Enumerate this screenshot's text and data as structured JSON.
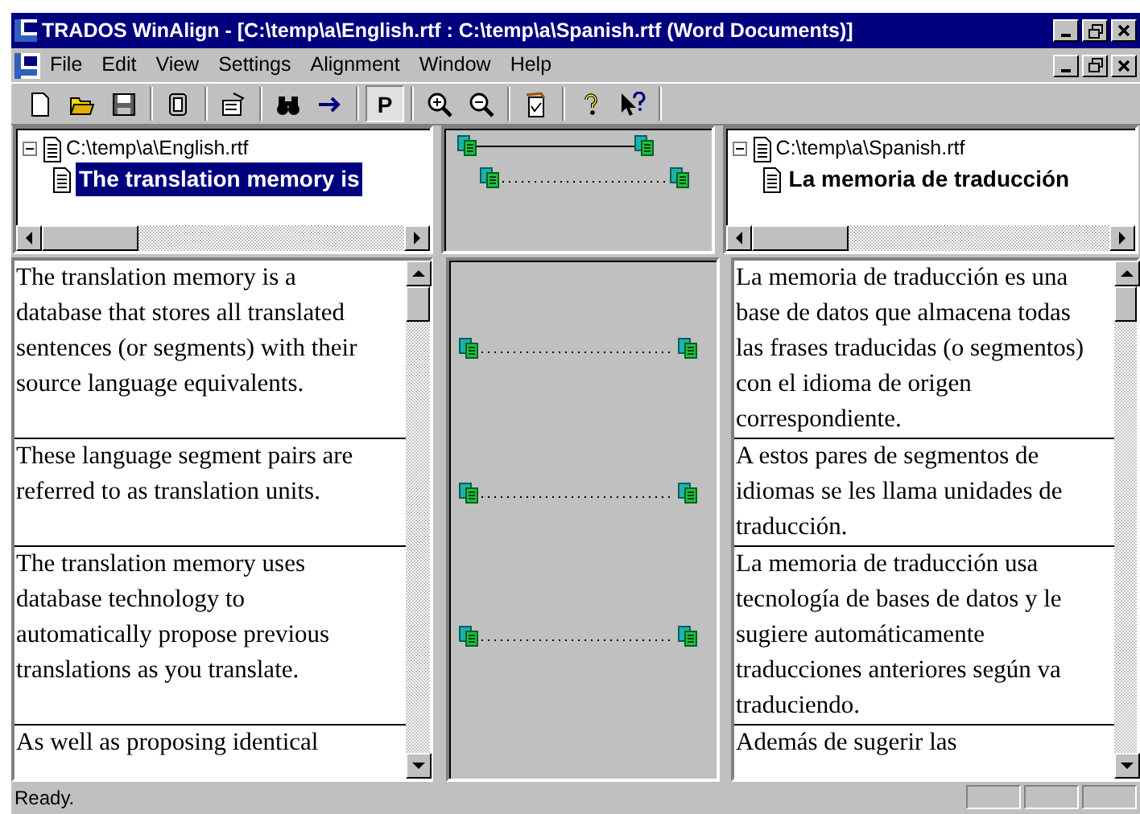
{
  "window": {
    "title": "TRADOS WinAlign - [C:\\temp\\a\\English.rtf : C:\\temp\\a\\Spanish.rtf (Word Documents)]"
  },
  "menu": [
    "File",
    "Edit",
    "View",
    "Settings",
    "Alignment",
    "Window",
    "Help"
  ],
  "toolbar": {
    "p_button": {
      "label": "P",
      "selected": true
    }
  },
  "source_tree": {
    "file": "C:\\temp\\a\\English.rtf",
    "expanded": true,
    "segment": {
      "label": "The translation memory is",
      "selected": true
    }
  },
  "tree_links": [
    {
      "kind": "solid"
    },
    {
      "kind": "dotted"
    }
  ],
  "target_tree": {
    "file": "C:\\temp\\a\\Spanish.rtf",
    "expanded": true,
    "segment": {
      "label": "La memoria de traducción",
      "selected": false
    }
  },
  "segments": [
    {
      "source": "The translation memory is a\ndatabase that stores all translated\nsentences (or segments) with their\nsource language equivalents.",
      "target": "La memoria de traducción es una\nbase de datos que almacena todas\nlas frases traducidas (o segmentos)\ncon el idioma de origen\ncorrespondiente.",
      "linked": true
    },
    {
      "source": "These language segment pairs are\nreferred to as translation units.",
      "target": "A estos pares de segmentos de\nidiomas se les llama unidades de\ntraducción.",
      "linked": true
    },
    {
      "source": "The translation memory uses\ndatabase technology to\nautomatically propose previous\ntranslations as you translate.",
      "target": "La memoria de traducción usa\ntecnología de bases de datos y le\nsugiere automáticamente\ntraducciones anteriores según va\ntraduciendo.",
      "linked": true
    },
    {
      "source": "As well as proposing identical",
      "target": "Además de sugerir las",
      "linked": false
    }
  ],
  "status_bar": {
    "text": "Ready."
  }
}
